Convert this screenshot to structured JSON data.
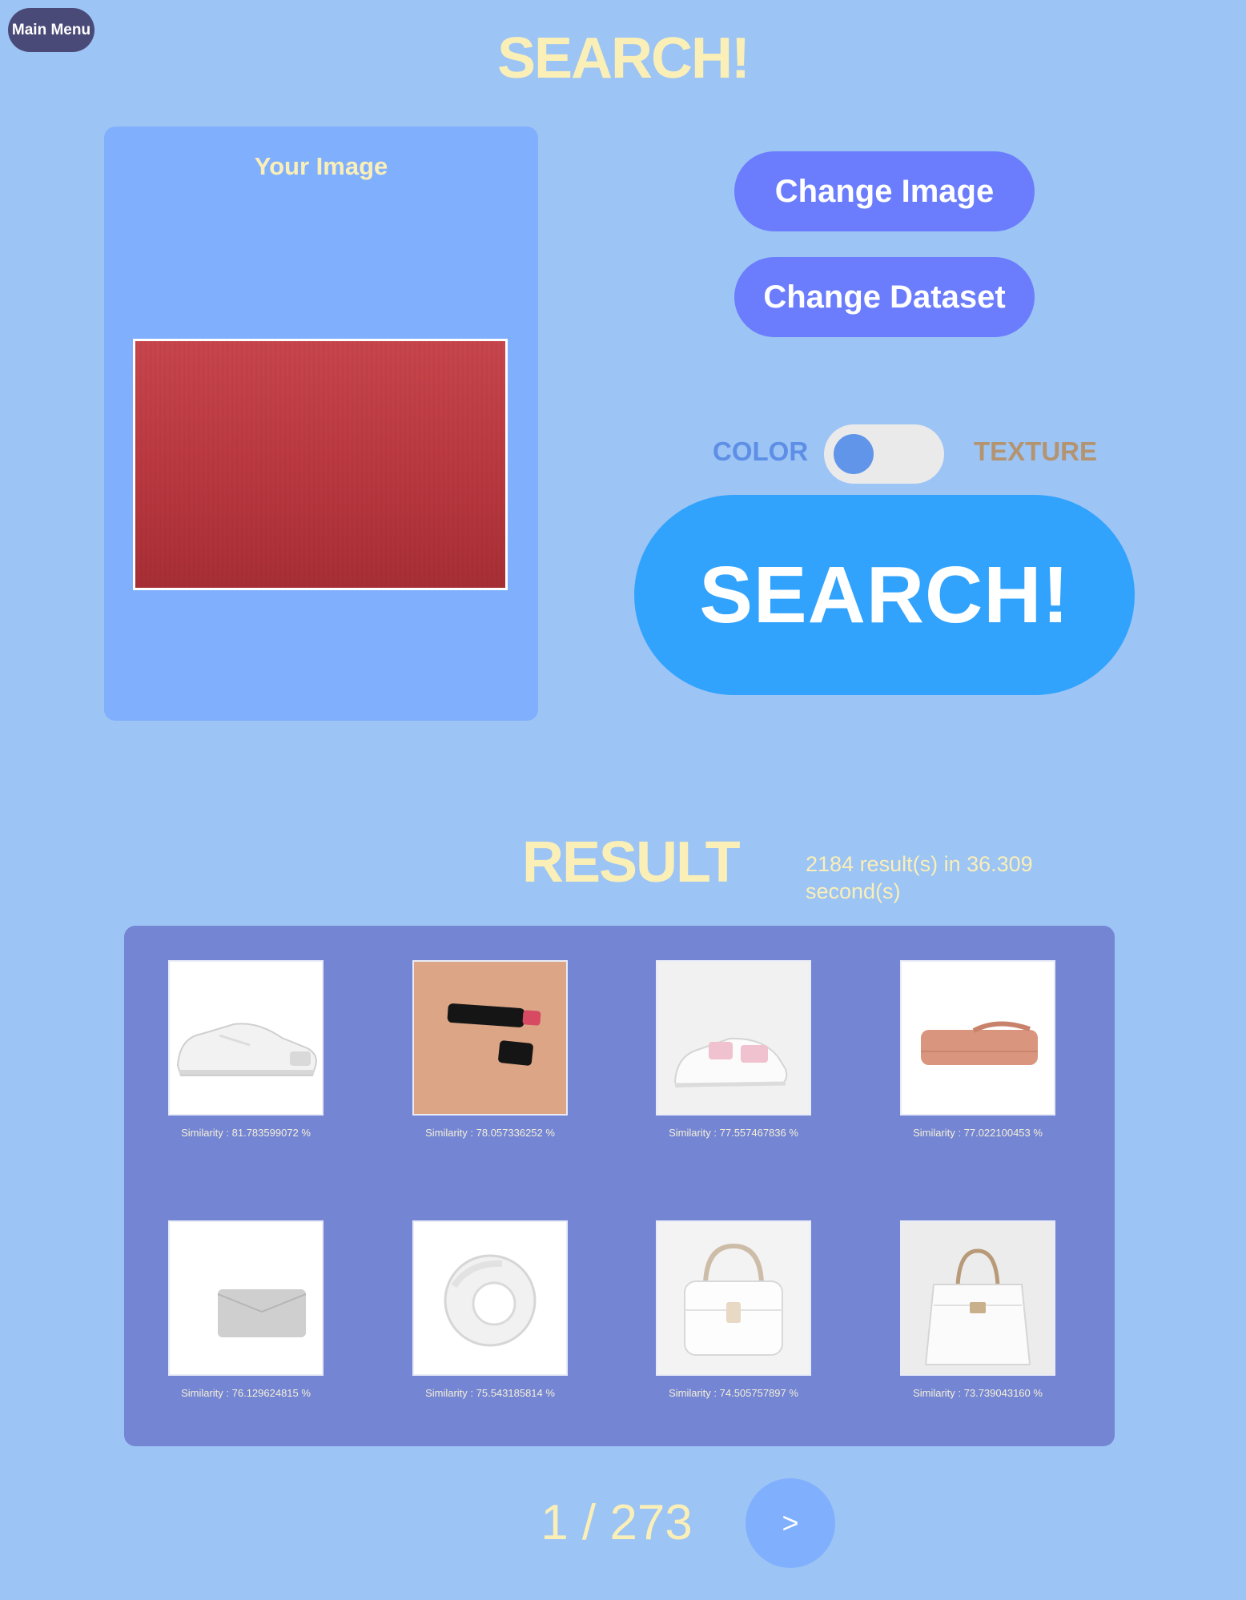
{
  "header": {
    "main_menu_label": "Main Menu",
    "title": "SEARCH!"
  },
  "query": {
    "panel_title": "Your Image"
  },
  "controls": {
    "change_image_label": "Change Image",
    "change_dataset_label": "Change Dataset",
    "toggle_left_label": "COLOR",
    "toggle_right_label": "TEXTURE",
    "toggle_state": "COLOR",
    "search_label": "SEARCH!"
  },
  "results": {
    "title": "RESULT",
    "summary": "2184 result(s) in 36.309 second(s)",
    "items": [
      {
        "similarity": "Similarity : 81.783599072 %",
        "thumb": "white-sneaker"
      },
      {
        "similarity": "Similarity : 78.057336252 %",
        "thumb": "lipstick"
      },
      {
        "similarity": "Similarity : 77.557467836 %",
        "thumb": "pink-strap-sneaker"
      },
      {
        "similarity": "Similarity : 77.022100453 %",
        "thumb": "peach-clutch"
      },
      {
        "similarity": "Similarity : 76.129624815 %",
        "thumb": "silver-clutch"
      },
      {
        "similarity": "Similarity : 75.543185814 %",
        "thumb": "clear-ring"
      },
      {
        "similarity": "Similarity : 74.505757897 %",
        "thumb": "white-handbag-chain"
      },
      {
        "similarity": "Similarity : 73.739043160 %",
        "thumb": "white-handbag"
      }
    ]
  },
  "pagination": {
    "label": "1 / 273",
    "next_label": ">"
  }
}
